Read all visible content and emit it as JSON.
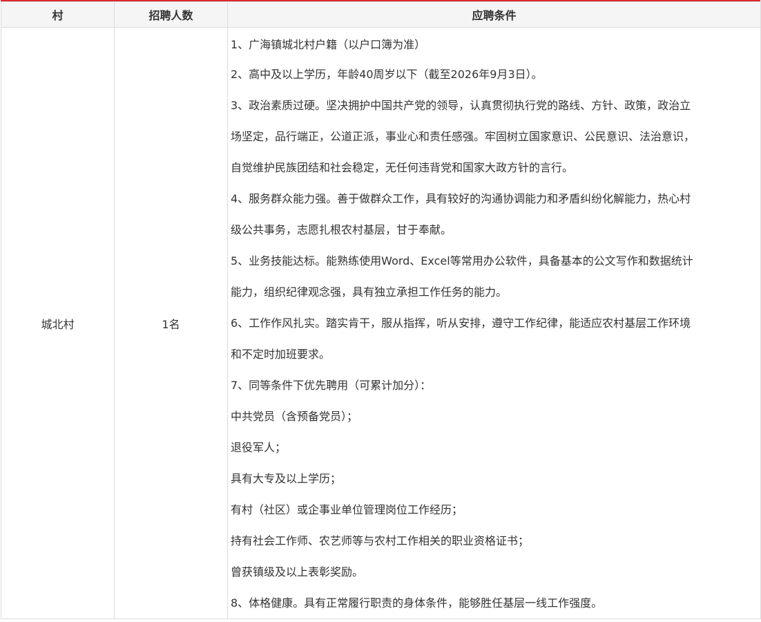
{
  "table": {
    "headers": {
      "village": "村",
      "count": "招聘人数",
      "conditions": "应聘条件"
    },
    "row": {
      "village": "城北村",
      "count": "1名",
      "lines": [
        "1、广海镇城北村户籍（以户口簿为准）",
        "2、高中及以上学历，年龄40周岁以下（截至2026年9月3日）。",
        "3、政治素质过硬。坚决拥护中国共产党的领导，认真贯彻执行党的路线、方针、政策，政治立",
        "场坚定，品行端正，公道正派，事业心和责任感强。牢固树立国家意识、公民意识、法治意识，",
        "自觉维护民族团结和社会稳定，无任何违背党和国家大政方针的言行。",
        "4、服务群众能力强。善于做群众工作，具有较好的沟通协调能力和矛盾纠纷化解能力，热心村",
        "级公共事务，志愿扎根农村基层，甘于奉献。",
        "5、业务技能达标。能熟练使用Word、Excel等常用办公软件，具备基本的公文写作和数据统计",
        "能力，组织纪律观念强，具有独立承担工作任务的能力。",
        "6、工作作风扎实。踏实肯干，服从指挥，听从安排，遵守工作纪律，能适应农村基层工作环境",
        "和不定时加班要求。",
        "7、同等条件下优先聘用（可累计加分）：",
        "中共党员（含预备党员）；",
        "退役军人；",
        "具有大专及以上学历；",
        "有村（社区）或企事业单位管理岗位工作经历；",
        "持有社会工作师、农艺师等与农村工作相关的职业资格证书；",
        "曾获镇级及以上表彰奖励。",
        "8、体格健康。具有正常履行职责的身体条件，能够胜任基层一线工作强度。"
      ]
    }
  }
}
